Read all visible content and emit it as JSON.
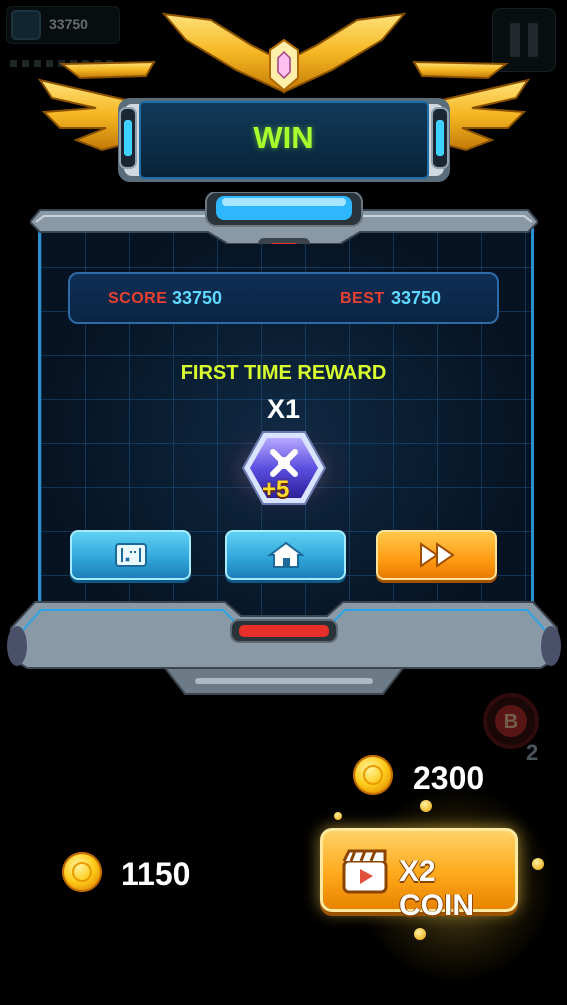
{
  "hud": {
    "score": "33750",
    "icons": [
      "avatar-icon",
      "pause-icon"
    ]
  },
  "result": {
    "title": "WIN"
  },
  "stats": {
    "score_label": "SCORE",
    "score_value": "33750",
    "best_label": "BEST",
    "best_value": "33750"
  },
  "reward": {
    "title": "FIRST TIME REWARD",
    "multiplier": "X1",
    "amount": "+5",
    "icon": "gem-badge-icon"
  },
  "buttons": {
    "map_icon": "map-icon",
    "home_icon": "home-icon",
    "next_icon": "fast-forward-icon"
  },
  "coins": {
    "reward": "2300",
    "total": "1150",
    "double_label": "X2 COIN",
    "double_icon": "video-clapper-icon"
  },
  "booster": {
    "letter": "B",
    "count": "2"
  },
  "colors": {
    "win_text": "#a8ff2e",
    "stat_label": "#e94030",
    "stat_value": "#5fd8ff",
    "reward_title": "#d9ff2e",
    "button_blue": "#2ea3d8",
    "button_orange": "#ff9c14"
  }
}
